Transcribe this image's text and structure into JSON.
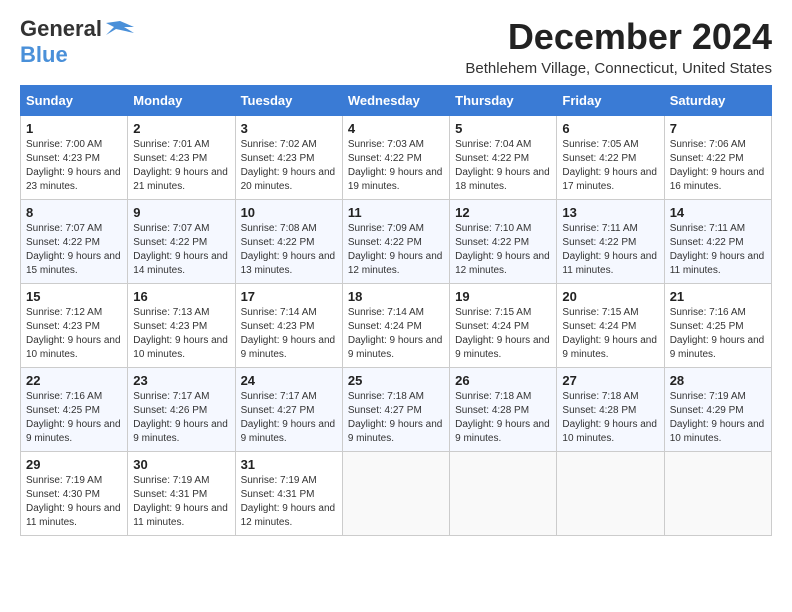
{
  "logo": {
    "line1": "General",
    "line2": "Blue"
  },
  "title": "December 2024",
  "subtitle": "Bethlehem Village, Connecticut, United States",
  "days_of_week": [
    "Sunday",
    "Monday",
    "Tuesday",
    "Wednesday",
    "Thursday",
    "Friday",
    "Saturday"
  ],
  "weeks": [
    [
      {
        "day": "1",
        "sunrise": "Sunrise: 7:00 AM",
        "sunset": "Sunset: 4:23 PM",
        "daylight": "Daylight: 9 hours and 23 minutes."
      },
      {
        "day": "2",
        "sunrise": "Sunrise: 7:01 AM",
        "sunset": "Sunset: 4:23 PM",
        "daylight": "Daylight: 9 hours and 21 minutes."
      },
      {
        "day": "3",
        "sunrise": "Sunrise: 7:02 AM",
        "sunset": "Sunset: 4:23 PM",
        "daylight": "Daylight: 9 hours and 20 minutes."
      },
      {
        "day": "4",
        "sunrise": "Sunrise: 7:03 AM",
        "sunset": "Sunset: 4:22 PM",
        "daylight": "Daylight: 9 hours and 19 minutes."
      },
      {
        "day": "5",
        "sunrise": "Sunrise: 7:04 AM",
        "sunset": "Sunset: 4:22 PM",
        "daylight": "Daylight: 9 hours and 18 minutes."
      },
      {
        "day": "6",
        "sunrise": "Sunrise: 7:05 AM",
        "sunset": "Sunset: 4:22 PM",
        "daylight": "Daylight: 9 hours and 17 minutes."
      },
      {
        "day": "7",
        "sunrise": "Sunrise: 7:06 AM",
        "sunset": "Sunset: 4:22 PM",
        "daylight": "Daylight: 9 hours and 16 minutes."
      }
    ],
    [
      {
        "day": "8",
        "sunrise": "Sunrise: 7:07 AM",
        "sunset": "Sunset: 4:22 PM",
        "daylight": "Daylight: 9 hours and 15 minutes."
      },
      {
        "day": "9",
        "sunrise": "Sunrise: 7:07 AM",
        "sunset": "Sunset: 4:22 PM",
        "daylight": "Daylight: 9 hours and 14 minutes."
      },
      {
        "day": "10",
        "sunrise": "Sunrise: 7:08 AM",
        "sunset": "Sunset: 4:22 PM",
        "daylight": "Daylight: 9 hours and 13 minutes."
      },
      {
        "day": "11",
        "sunrise": "Sunrise: 7:09 AM",
        "sunset": "Sunset: 4:22 PM",
        "daylight": "Daylight: 9 hours and 12 minutes."
      },
      {
        "day": "12",
        "sunrise": "Sunrise: 7:10 AM",
        "sunset": "Sunset: 4:22 PM",
        "daylight": "Daylight: 9 hours and 12 minutes."
      },
      {
        "day": "13",
        "sunrise": "Sunrise: 7:11 AM",
        "sunset": "Sunset: 4:22 PM",
        "daylight": "Daylight: 9 hours and 11 minutes."
      },
      {
        "day": "14",
        "sunrise": "Sunrise: 7:11 AM",
        "sunset": "Sunset: 4:22 PM",
        "daylight": "Daylight: 9 hours and 11 minutes."
      }
    ],
    [
      {
        "day": "15",
        "sunrise": "Sunrise: 7:12 AM",
        "sunset": "Sunset: 4:23 PM",
        "daylight": "Daylight: 9 hours and 10 minutes."
      },
      {
        "day": "16",
        "sunrise": "Sunrise: 7:13 AM",
        "sunset": "Sunset: 4:23 PM",
        "daylight": "Daylight: 9 hours and 10 minutes."
      },
      {
        "day": "17",
        "sunrise": "Sunrise: 7:14 AM",
        "sunset": "Sunset: 4:23 PM",
        "daylight": "Daylight: 9 hours and 9 minutes."
      },
      {
        "day": "18",
        "sunrise": "Sunrise: 7:14 AM",
        "sunset": "Sunset: 4:24 PM",
        "daylight": "Daylight: 9 hours and 9 minutes."
      },
      {
        "day": "19",
        "sunrise": "Sunrise: 7:15 AM",
        "sunset": "Sunset: 4:24 PM",
        "daylight": "Daylight: 9 hours and 9 minutes."
      },
      {
        "day": "20",
        "sunrise": "Sunrise: 7:15 AM",
        "sunset": "Sunset: 4:24 PM",
        "daylight": "Daylight: 9 hours and 9 minutes."
      },
      {
        "day": "21",
        "sunrise": "Sunrise: 7:16 AM",
        "sunset": "Sunset: 4:25 PM",
        "daylight": "Daylight: 9 hours and 9 minutes."
      }
    ],
    [
      {
        "day": "22",
        "sunrise": "Sunrise: 7:16 AM",
        "sunset": "Sunset: 4:25 PM",
        "daylight": "Daylight: 9 hours and 9 minutes."
      },
      {
        "day": "23",
        "sunrise": "Sunrise: 7:17 AM",
        "sunset": "Sunset: 4:26 PM",
        "daylight": "Daylight: 9 hours and 9 minutes."
      },
      {
        "day": "24",
        "sunrise": "Sunrise: 7:17 AM",
        "sunset": "Sunset: 4:27 PM",
        "daylight": "Daylight: 9 hours and 9 minutes."
      },
      {
        "day": "25",
        "sunrise": "Sunrise: 7:18 AM",
        "sunset": "Sunset: 4:27 PM",
        "daylight": "Daylight: 9 hours and 9 minutes."
      },
      {
        "day": "26",
        "sunrise": "Sunrise: 7:18 AM",
        "sunset": "Sunset: 4:28 PM",
        "daylight": "Daylight: 9 hours and 9 minutes."
      },
      {
        "day": "27",
        "sunrise": "Sunrise: 7:18 AM",
        "sunset": "Sunset: 4:28 PM",
        "daylight": "Daylight: 9 hours and 10 minutes."
      },
      {
        "day": "28",
        "sunrise": "Sunrise: 7:19 AM",
        "sunset": "Sunset: 4:29 PM",
        "daylight": "Daylight: 9 hours and 10 minutes."
      }
    ],
    [
      {
        "day": "29",
        "sunrise": "Sunrise: 7:19 AM",
        "sunset": "Sunset: 4:30 PM",
        "daylight": "Daylight: 9 hours and 11 minutes."
      },
      {
        "day": "30",
        "sunrise": "Sunrise: 7:19 AM",
        "sunset": "Sunset: 4:31 PM",
        "daylight": "Daylight: 9 hours and 11 minutes."
      },
      {
        "day": "31",
        "sunrise": "Sunrise: 7:19 AM",
        "sunset": "Sunset: 4:31 PM",
        "daylight": "Daylight: 9 hours and 12 minutes."
      },
      null,
      null,
      null,
      null
    ]
  ]
}
